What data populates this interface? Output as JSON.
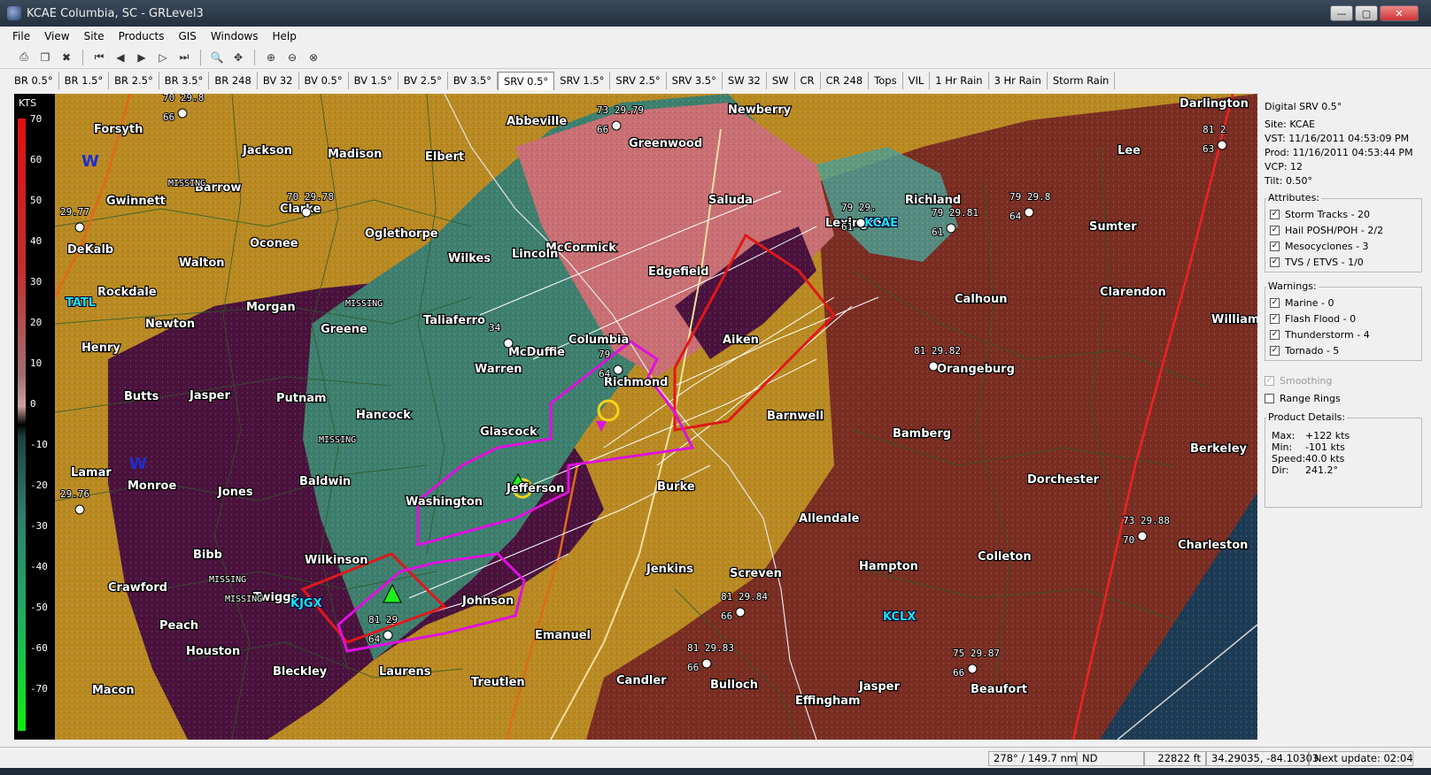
{
  "window": {
    "title": "KCAE Columbia, SC - GRLevel3",
    "minimize": "—",
    "maximize": "▢",
    "close": "✕"
  },
  "menu": [
    "File",
    "View",
    "Site",
    "Products",
    "GIS",
    "Windows",
    "Help"
  ],
  "products": [
    "BR 0.5°",
    "BR 1.5°",
    "BR 2.5°",
    "BR 3.5°",
    "BR 248",
    "BV 32",
    "BV 0.5°",
    "BV 1.5°",
    "BV 2.5°",
    "BV 3.5°",
    "SRV 0.5°",
    "SRV 1.5°",
    "SRV 2.5°",
    "SRV 3.5°",
    "SW 32",
    "SW",
    "CR",
    "CR 248",
    "Tops",
    "VIL",
    "1 Hr Rain",
    "3 Hr Rain",
    "Storm Rain"
  ],
  "active_product": "SRV 0.5°",
  "scale": {
    "unit": "KTS",
    "ticks": [
      "70",
      "60",
      "50",
      "40",
      "30",
      "20",
      "10",
      "0",
      "-10",
      "-20",
      "-30",
      "-40",
      "-50",
      "-60",
      "-70"
    ]
  },
  "panel": {
    "product_name": "Digital SRV 0.5°",
    "site": "Site:  KCAE",
    "vst": "VST:  11/16/2011  04:53:09 PM",
    "prod": "Prod: 11/16/2011  04:53:44 PM",
    "vcp": "VCP:  12",
    "tilt": "Tilt:   0.50°",
    "attributes_label": "Attributes:",
    "attributes": [
      "Storm Tracks - 20",
      "Hail POSH/POH - 2/2",
      "Mesocyclones - 3",
      "TVS / ETVS - 1/0"
    ],
    "warnings_label": "Warnings:",
    "warnings": [
      "Marine - 0",
      "Flash Flood - 0",
      "Thunderstorm - 4",
      "Tornado - 5"
    ],
    "smoothing": "Smoothing",
    "range_rings": "Range Rings",
    "details_label": "Product Details:",
    "details": [
      {
        "key": "Max:",
        "value": "+122 kts"
      },
      {
        "key": "Min:",
        "value": "-101 kts"
      },
      {
        "key": "Speed:",
        "value": "40.0 kts"
      },
      {
        "key": "Dir:",
        "value": "241.2°"
      }
    ]
  },
  "status": {
    "bearing": "278° / 149.7 nm",
    "nd": "ND",
    "height": "22822 ft",
    "coords": "34.29035, -84.10303",
    "next_update": "Next update: 02:04"
  },
  "map": {
    "places": [
      {
        "name": "Forsyth"
      },
      {
        "name": "Jackson"
      },
      {
        "name": "Madison"
      },
      {
        "name": "Elbert"
      },
      {
        "name": "Abbeville"
      },
      {
        "name": "Greenwood"
      },
      {
        "name": "Newberry"
      },
      {
        "name": "Darlington"
      },
      {
        "name": "Lee"
      },
      {
        "name": "Barrow"
      },
      {
        "name": "Gwinnett"
      },
      {
        "name": "Clarke"
      },
      {
        "name": "Saluda"
      },
      {
        "name": "Richland"
      },
      {
        "name": "Sumter"
      },
      {
        "name": "DeKalb"
      },
      {
        "name": "Oconee"
      },
      {
        "name": "Oglethorpe"
      },
      {
        "name": "Wilkes"
      },
      {
        "name": "McCormick"
      },
      {
        "name": "Lincoln"
      },
      {
        "name": "Edgefield"
      },
      {
        "name": "Lexington"
      },
      {
        "name": "Walton"
      },
      {
        "name": "Rockdale"
      },
      {
        "name": "Morgan"
      },
      {
        "name": "Taliaferro"
      },
      {
        "name": "Calhoun"
      },
      {
        "name": "Clarendon"
      },
      {
        "name": "Williamsburg"
      },
      {
        "name": "Newton"
      },
      {
        "name": "Greene"
      },
      {
        "name": "McDuffie"
      },
      {
        "name": "Columbia"
      },
      {
        "name": "Aiken"
      },
      {
        "name": "Henry"
      },
      {
        "name": "Warren"
      },
      {
        "name": "Richmond"
      },
      {
        "name": "Orangeburg"
      },
      {
        "name": "Butts"
      },
      {
        "name": "Jasper"
      },
      {
        "name": "Putnam"
      },
      {
        "name": "Hancock"
      },
      {
        "name": "Barnwell"
      },
      {
        "name": "Glascock"
      },
      {
        "name": "Bamberg"
      },
      {
        "name": "Berkeley"
      },
      {
        "name": "Lamar"
      },
      {
        "name": "Monroe"
      },
      {
        "name": "Jones"
      },
      {
        "name": "Baldwin"
      },
      {
        "name": "Jefferson"
      },
      {
        "name": "Burke"
      },
      {
        "name": "Dorchester"
      },
      {
        "name": "Washington"
      },
      {
        "name": "Allendale"
      },
      {
        "name": "Bibb"
      },
      {
        "name": "Wilkinson"
      },
      {
        "name": "Jenkins"
      },
      {
        "name": "Screven"
      },
      {
        "name": "Hampton"
      },
      {
        "name": "Colleton"
      },
      {
        "name": "Charleston"
      },
      {
        "name": "Crawford"
      },
      {
        "name": "Twiggs"
      },
      {
        "name": "Johnson"
      },
      {
        "name": "Peach"
      },
      {
        "name": "Emanuel"
      },
      {
        "name": "Houston"
      },
      {
        "name": "Laurens"
      },
      {
        "name": "Bleckley"
      },
      {
        "name": "Treutlen"
      },
      {
        "name": "Candler"
      },
      {
        "name": "Bulloch"
      },
      {
        "name": "Jasper"
      },
      {
        "name": "Beaufort"
      },
      {
        "name": "Effingham"
      },
      {
        "name": "Macon"
      }
    ],
    "radars": [
      "KCAE",
      "KJGX",
      "KCLX",
      "TATL"
    ],
    "stations": [
      {
        "t": "70",
        "p": "29.8",
        "d": "66"
      },
      {
        "t": "73",
        "p": "29.79",
        "d": "66"
      },
      {
        "t": "81",
        "p": "2",
        "d": "63"
      },
      {
        "t": "70",
        "p": "29.78",
        "d": ""
      },
      {
        "t": "79",
        "p": "29.8",
        "d": "64"
      },
      {
        "t": "79",
        "p": "29.",
        "d": "61"
      },
      {
        "t": "79",
        "p": "29.81",
        "d": "61"
      },
      {
        "t": "",
        "p": "29.77",
        "d": ""
      },
      {
        "t": "81",
        "p": "29.82",
        "d": ""
      },
      {
        "t": "",
        "p": "29.76",
        "d": ""
      },
      {
        "t": "73",
        "p": "29.88",
        "d": "70"
      },
      {
        "t": "81",
        "p": "29.84",
        "d": "66"
      },
      {
        "t": "81",
        "p": "29.83",
        "d": "66"
      },
      {
        "t": "75",
        "p": "29.87",
        "d": "66"
      },
      {
        "t": "81",
        "p": "29",
        "d": "64"
      },
      {
        "t": "34",
        "p": "",
        "d": ""
      },
      {
        "t": "79",
        "p": "",
        "d": "64"
      }
    ],
    "missing": "MISSING",
    "warn_marker": "W"
  }
}
